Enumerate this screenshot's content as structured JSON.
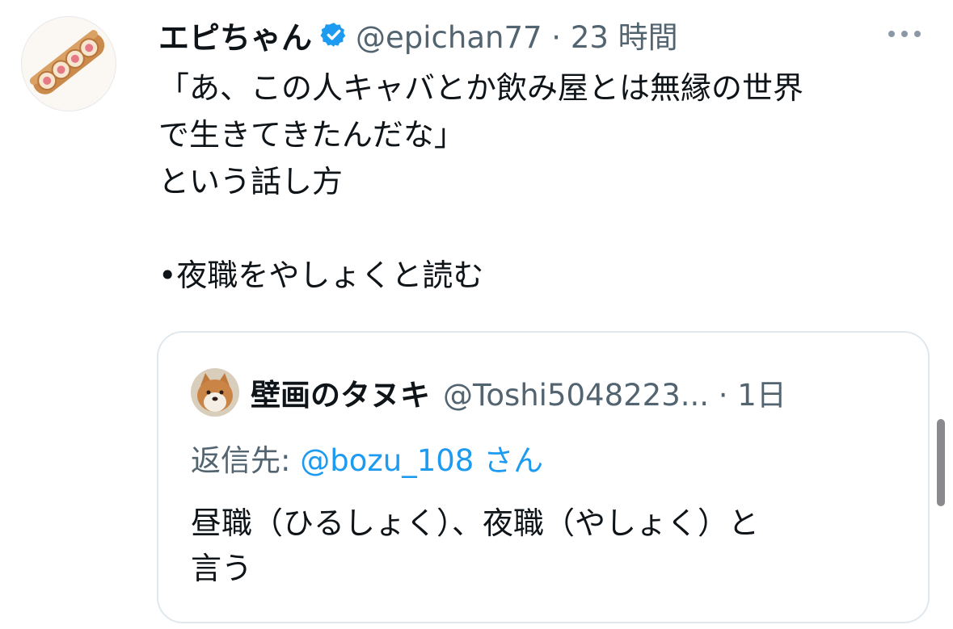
{
  "tweet": {
    "author_name": "エピちゃん",
    "handle_meta": "@epichan77 · 23 時間",
    "text": "「あ、この人キャバとか飲み屋とは無縁の世界\nで生きてきたんだな」\nという話し方\n\n•夜職をやしょくと読む",
    "icons": {
      "verified": "verified-badge-icon",
      "more": "more-options-icon",
      "avatar": "bread-pastry-avatar"
    },
    "colors": {
      "verified": "#1d9bf0",
      "meta": "#536471",
      "text": "#0f1419"
    }
  },
  "quote": {
    "author_name": "壁画のタヌキ",
    "handle_meta": "@Toshi5048223... · 1日",
    "reply_prefix": "返信先: ",
    "reply_handle": "@bozu_108 さん",
    "text": "昼職（ひるしょく）、夜職（やしょく）と\n言う",
    "icons": {
      "avatar": "shiba-dog-avatar"
    },
    "colors": {
      "link": "#1d9bf0",
      "border": "#e1e8ed"
    }
  }
}
